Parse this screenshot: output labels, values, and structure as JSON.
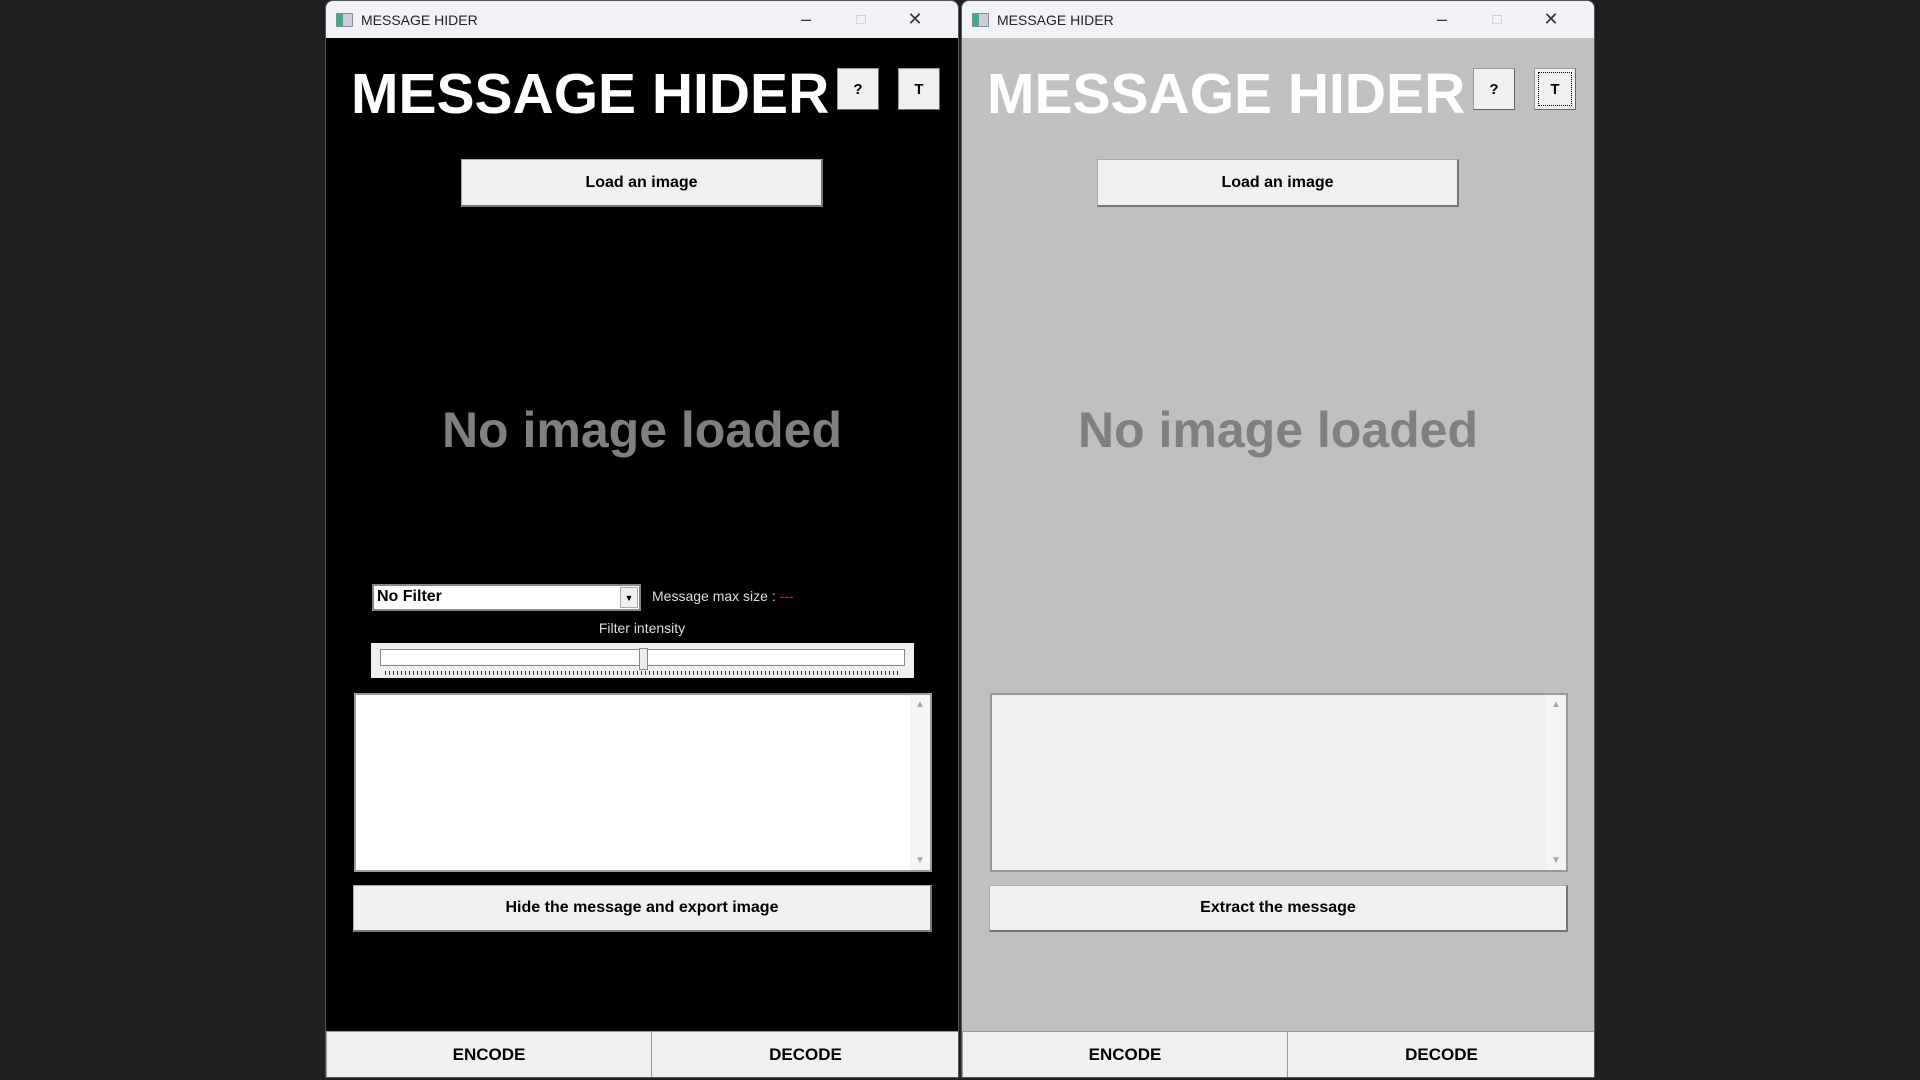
{
  "windows": [
    {
      "title": "MESSAGE HIDER",
      "app_title": "MESSAGE HIDER",
      "help_label": "?",
      "theme_label": "T",
      "load_label": "Load an image",
      "placeholder_text": "No image loaded",
      "filter_value": "No Filter",
      "max_size_label": "Message max size :",
      "max_size_value": "---",
      "filter_intensity_label": "Filter intensity",
      "filter_intensity_percent": 50,
      "action_label": "Hide the message and export image",
      "tabs": [
        "ENCODE",
        "DECODE"
      ],
      "background": "#000000"
    },
    {
      "title": "MESSAGE HIDER",
      "app_title": "MESSAGE HIDER",
      "help_label": "?",
      "theme_label": "T",
      "load_label": "Load an image",
      "placeholder_text": "No image loaded",
      "action_label": "Extract the message",
      "tabs": [
        "ENCODE",
        "DECODE"
      ],
      "background": "#c0c0c0"
    }
  ],
  "icons": {
    "minimize": "minimize-icon",
    "maximize": "maximize-icon",
    "close": "close-icon"
  }
}
